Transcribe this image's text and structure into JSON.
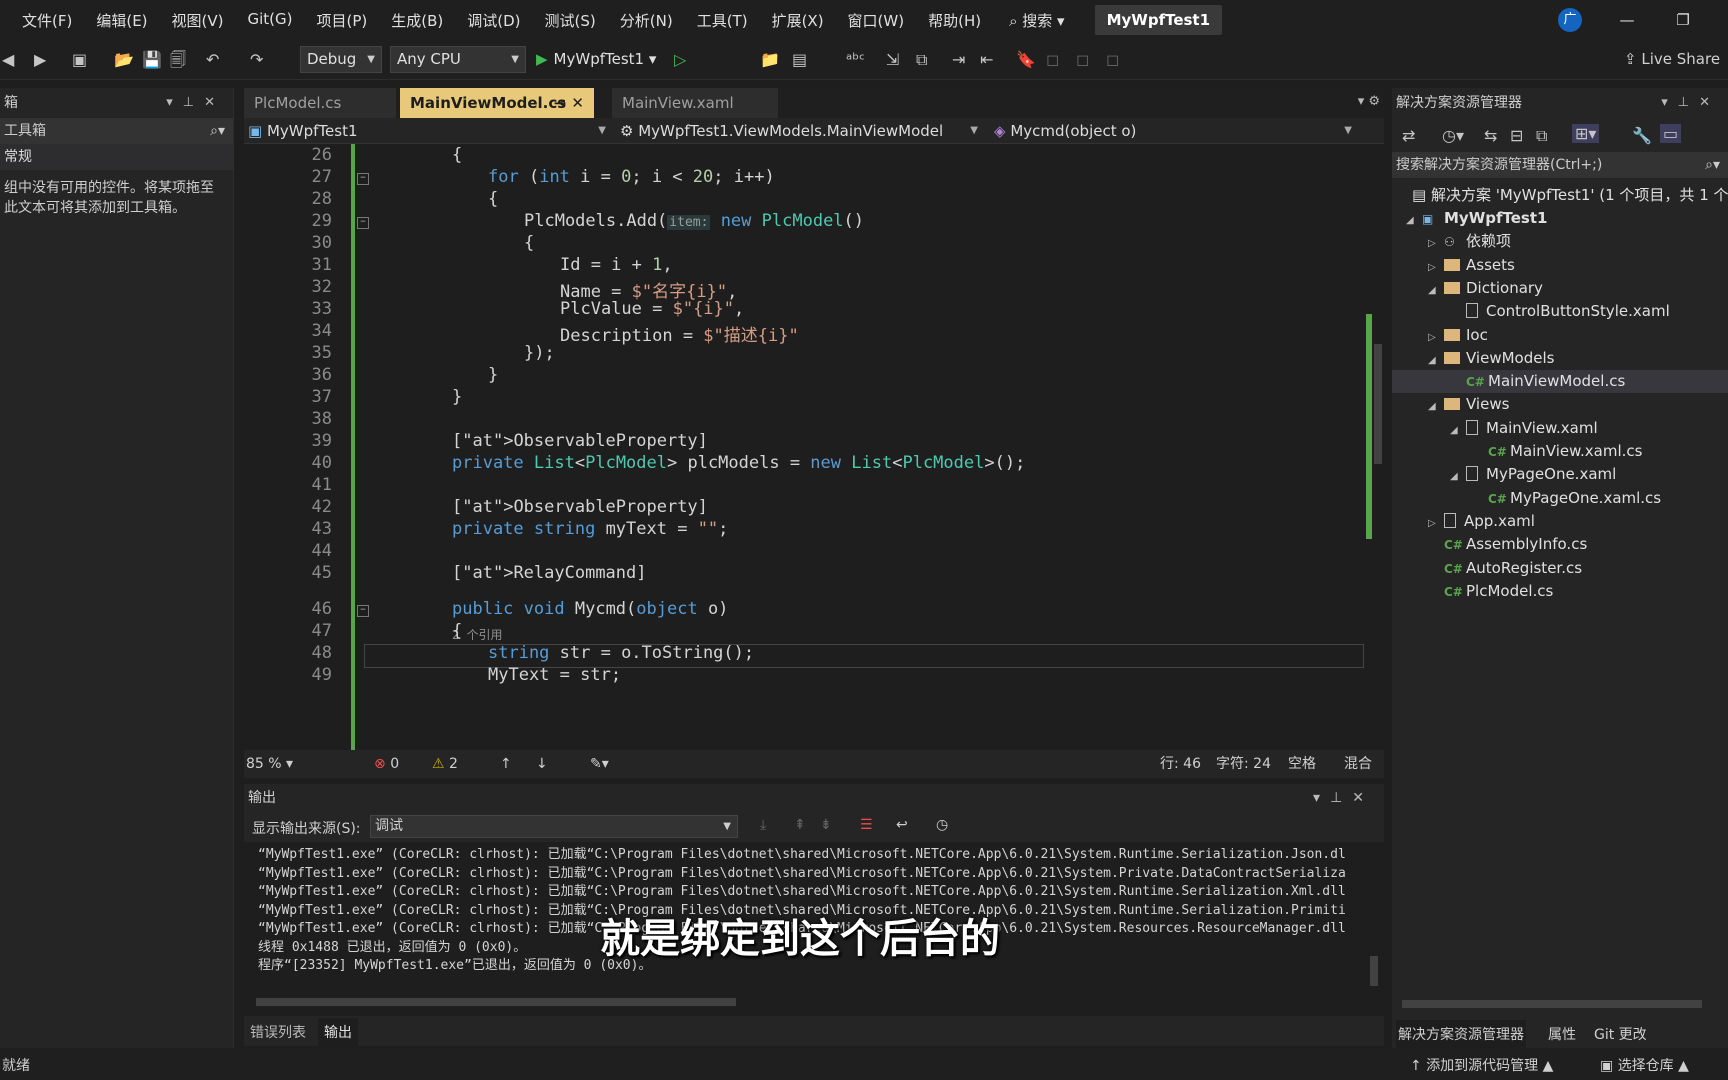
{
  "menu": [
    "文件(F)",
    "编辑(E)",
    "视图(V)",
    "Git(G)",
    "项目(P)",
    "生成(B)",
    "调试(D)",
    "测试(S)",
    "分析(N)",
    "工具(T)",
    "扩展(X)",
    "窗口(W)",
    "帮助(H)"
  ],
  "search_label": "搜索",
  "window_title": "MyWpfTest1",
  "avatar_initial": "广",
  "toolbar": {
    "config": "Debug",
    "platform": "Any CPU",
    "run_target": "MyWpfTest1",
    "live_share": "Live Share"
  },
  "toolbox": {
    "title": "箱",
    "search": "工具箱",
    "group": "常规",
    "message_line1": "组中没有可用的控件。将某项拖至",
    "message_line2": "此文本可将其添加到工具箱。"
  },
  "tabs": [
    {
      "label": "PlcModel.cs",
      "active": false
    },
    {
      "label": "MainViewModel.cs",
      "active": true
    },
    {
      "label": "MainView.xaml",
      "active": false
    }
  ],
  "nav": {
    "project": "MyWpfTest1",
    "class": "MyWpfTest1.ViewModels.MainViewModel",
    "member": "Mycmd(object o)"
  },
  "code": {
    "refs_hint": "2 个引用",
    "lines": [
      {
        "n": "26",
        "t": "{"
      },
      {
        "n": "27",
        "t": "for (int i = 0; i < 20; i++)"
      },
      {
        "n": "28",
        "t": "{"
      },
      {
        "n": "29",
        "t": "PlcModels.Add(item: new PlcModel()"
      },
      {
        "n": "30",
        "t": "{"
      },
      {
        "n": "31",
        "t": "Id = i + 1,"
      },
      {
        "n": "32",
        "t": "Name = $\"名字{i}\","
      },
      {
        "n": "33",
        "t": "PlcValue = $\"{i}\","
      },
      {
        "n": "34",
        "t": "Description = $\"描述{i}\""
      },
      {
        "n": "35",
        "t": "});"
      },
      {
        "n": "36",
        "t": "}"
      },
      {
        "n": "37",
        "t": "}"
      },
      {
        "n": "38",
        "t": ""
      },
      {
        "n": "39",
        "t": "[ObservableProperty]"
      },
      {
        "n": "40",
        "t": "private List<PlcModel> plcModels = new List<PlcModel>();"
      },
      {
        "n": "41",
        "t": ""
      },
      {
        "n": "42",
        "t": "[ObservableProperty]"
      },
      {
        "n": "43",
        "t": "private string myText = \"\";"
      },
      {
        "n": "44",
        "t": ""
      },
      {
        "n": "45",
        "t": "[RelayCommand]"
      },
      {
        "n": "46",
        "t": "public void Mycmd(object o)"
      },
      {
        "n": "47",
        "t": "{"
      },
      {
        "n": "48",
        "t": "string str = o.ToString();"
      },
      {
        "n": "49",
        "t": "MyText = str;"
      }
    ]
  },
  "editor_status": {
    "zoom": "85 %",
    "errors": "0",
    "warnings": "2",
    "line": "行: 46",
    "char": "字符: 24",
    "spaces": "空格",
    "eol": "混合"
  },
  "output": {
    "title": "输出",
    "source_label": "显示输出来源(S):",
    "source_value": "调试",
    "lines": [
      "“MyWpfTest1.exe” (CoreCLR: clrhost): 已加载“C:\\Program Files\\dotnet\\shared\\Microsoft.NETCore.App\\6.0.21\\System.Runtime.Serialization.Json.dl",
      "“MyWpfTest1.exe” (CoreCLR: clrhost): 已加载“C:\\Program Files\\dotnet\\shared\\Microsoft.NETCore.App\\6.0.21\\System.Private.DataContractSerializa",
      "“MyWpfTest1.exe” (CoreCLR: clrhost): 已加载“C:\\Program Files\\dotnet\\shared\\Microsoft.NETCore.App\\6.0.21\\System.Runtime.Serialization.Xml.dll",
      "“MyWpfTest1.exe” (CoreCLR: clrhost): 已加载“C:\\Program Files\\dotnet\\shared\\Microsoft.NETCore.App\\6.0.21\\System.Runtime.Serialization.Primiti",
      "“MyWpfTest1.exe” (CoreCLR: clrhost): 已加载“C:\\Program Files\\dotnet\\shared\\Microsoft.NETCore.App\\6.0.21\\System.Resources.ResourceManager.dll",
      "线程 0x1488 已退出，返回值为 0 (0x0)。",
      "程序“[23352] MyWpfTest1.exe”已退出，返回值为 0 (0x0)。"
    ],
    "tabs": [
      "错误列表",
      "输出"
    ]
  },
  "subtitle": "就是绑定到这个后台的",
  "solution": {
    "title": "解决方案资源管理器",
    "search": "搜索解决方案资源管理器(Ctrl+;)",
    "root": "解决方案 'MyWpfTest1' (1 个项目，共 1 个)",
    "items": [
      {
        "label": "MyWpfTest1",
        "depth": 0,
        "kind": "project",
        "tri": "◢"
      },
      {
        "label": "依赖项",
        "depth": 1,
        "kind": "deps",
        "tri": "▷"
      },
      {
        "label": "Assets",
        "depth": 1,
        "kind": "folder",
        "tri": "▷"
      },
      {
        "label": "Dictionary",
        "depth": 1,
        "kind": "folder",
        "tri": "◢"
      },
      {
        "label": "ControlButtonStyle.xaml",
        "depth": 2,
        "kind": "file",
        "tri": ""
      },
      {
        "label": "Ioc",
        "depth": 1,
        "kind": "folder",
        "tri": "▷"
      },
      {
        "label": "ViewModels",
        "depth": 1,
        "kind": "folder",
        "tri": "◢"
      },
      {
        "label": "MainViewModel.cs",
        "depth": 2,
        "kind": "cs",
        "tri": "",
        "selected": true
      },
      {
        "label": "Views",
        "depth": 1,
        "kind": "folder",
        "tri": "◢"
      },
      {
        "label": "MainView.xaml",
        "depth": 2,
        "kind": "file",
        "tri": "◢"
      },
      {
        "label": "MainView.xaml.cs",
        "depth": 3,
        "kind": "cs",
        "tri": ""
      },
      {
        "label": "MyPageOne.xaml",
        "depth": 2,
        "kind": "file",
        "tri": "◢"
      },
      {
        "label": "MyPageOne.xaml.cs",
        "depth": 3,
        "kind": "cs",
        "tri": ""
      },
      {
        "label": "App.xaml",
        "depth": 1,
        "kind": "file",
        "tri": "▷"
      },
      {
        "label": "AssemblyInfo.cs",
        "depth": 1,
        "kind": "cs",
        "tri": ""
      },
      {
        "label": "AutoRegister.cs",
        "depth": 1,
        "kind": "cs",
        "tri": ""
      },
      {
        "label": "PlcModel.cs",
        "depth": 1,
        "kind": "cs",
        "tri": ""
      }
    ],
    "tabs": [
      "解决方案资源管理器",
      "属性",
      "Git 更改"
    ]
  },
  "status": {
    "ready": "就绪",
    "add_source": "添加到源代码管理",
    "select_repo": "选择仓库"
  }
}
